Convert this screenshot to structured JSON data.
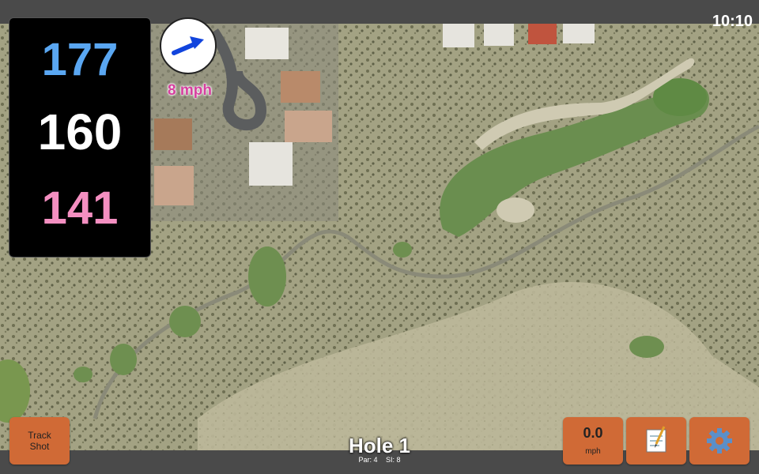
{
  "clock": "10:10",
  "distances": {
    "back": "177",
    "middle": "160",
    "front": "141"
  },
  "wind": {
    "speed": "8 mph",
    "icon": "wind-direction-arrow-icon"
  },
  "hole": {
    "title": "Hole 1",
    "par": "Par: 4",
    "stroke_index": "SI: 8"
  },
  "buttons": {
    "track_shot_line1": "Track",
    "track_shot_line2": "Shot",
    "speed_value": "0.0",
    "speed_unit": "mph",
    "notes_icon": "notepad-icon",
    "settings_icon": "gear-icon"
  },
  "colors": {
    "back_distance": "#5aa7f2",
    "middle_distance": "#ffffff",
    "front_distance": "#f48fc1",
    "button": "#d06a36",
    "wind_text": "#d6409f"
  }
}
